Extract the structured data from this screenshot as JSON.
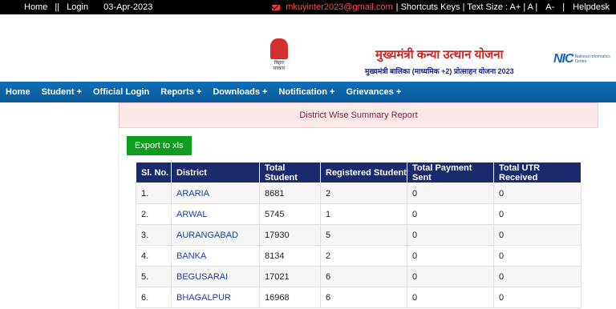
{
  "topbar": {
    "home": "Home",
    "sep1": "||",
    "login": "Login",
    "date": "03-Apr-2023",
    "email": "mkuyinter2023@gmail.com",
    "shortcuts": "| Shortcuts Keys | Text Size : A+ | A |",
    "a_minus": "A-",
    "sep2": "|",
    "helpdesk": "Helpdesk"
  },
  "header": {
    "emblem_caption": "बिहार सरकार",
    "title": "मुख्यमंत्री कन्या उत्थान योजना",
    "subtitle": "मुख्यमंत्री बालिका (माध्यमिक +2) प्रोत्साहन योजना 2023",
    "nic_mark": "NIC",
    "nic_text": "National Informatics Centre"
  },
  "nav": {
    "items": [
      {
        "label": "Home"
      },
      {
        "label": "Student +"
      },
      {
        "label": "Official Login"
      },
      {
        "label": "Reports +"
      },
      {
        "label": "Downloads +"
      },
      {
        "label": "Notification +"
      },
      {
        "label": "Grievances +"
      }
    ]
  },
  "report": {
    "title": "District Wise Summary Report",
    "export_label": "Export to xls",
    "columns": [
      "Sl. No.",
      "District",
      "Total Student",
      "Registered Student",
      "Total Payment Sent",
      "Total UTR Received"
    ],
    "rows": [
      [
        "1.",
        "ARARIA",
        "8681",
        "2",
        "0",
        "0"
      ],
      [
        "2.",
        "ARWAL",
        "5745",
        "1",
        "0",
        "0"
      ],
      [
        "3.",
        "AURANGABAD",
        "17930",
        "5",
        "0",
        "0"
      ],
      [
        "4.",
        "BANKA",
        "8134",
        "2",
        "0",
        "0"
      ],
      [
        "5.",
        "BEGUSARAI",
        "17021",
        "6",
        "0",
        "0"
      ],
      [
        "6.",
        "BHAGALPUR",
        "16968",
        "6",
        "0",
        "0"
      ]
    ]
  }
}
